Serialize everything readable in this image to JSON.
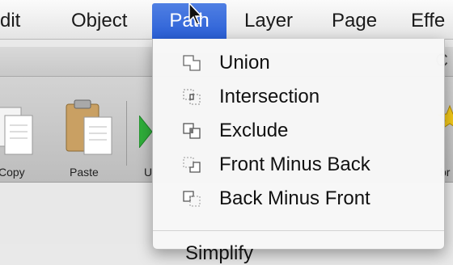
{
  "menubar": {
    "items": [
      {
        "label": "dit"
      },
      {
        "label": "Object"
      },
      {
        "label": "Path",
        "active": true
      },
      {
        "label": "Layer"
      },
      {
        "label": "Page"
      },
      {
        "label": "Effe"
      }
    ]
  },
  "titlebar": {
    "partial_text": "C"
  },
  "toolbar": {
    "buttons": [
      {
        "label": "Copy",
        "icon": "copy-icon"
      },
      {
        "label": "Paste",
        "icon": "paste-icon"
      },
      {
        "label": "U",
        "icon": "green-arrow-icon"
      },
      {
        "label": "br",
        "icon": "star-icon"
      }
    ]
  },
  "path_menu": {
    "items": [
      {
        "label": "Union",
        "icon": "union-icon"
      },
      {
        "label": "Intersection",
        "icon": "intersection-icon"
      },
      {
        "label": "Exclude",
        "icon": "exclude-icon"
      },
      {
        "label": "Front Minus Back",
        "icon": "front-minus-back-icon"
      },
      {
        "label": "Back Minus Front",
        "icon": "back-minus-front-icon"
      }
    ],
    "cut_item": "Simplify"
  },
  "colors": {
    "highlight": "#2f63d8",
    "star": "#f2c81a",
    "arrow": "#2fae3a"
  }
}
